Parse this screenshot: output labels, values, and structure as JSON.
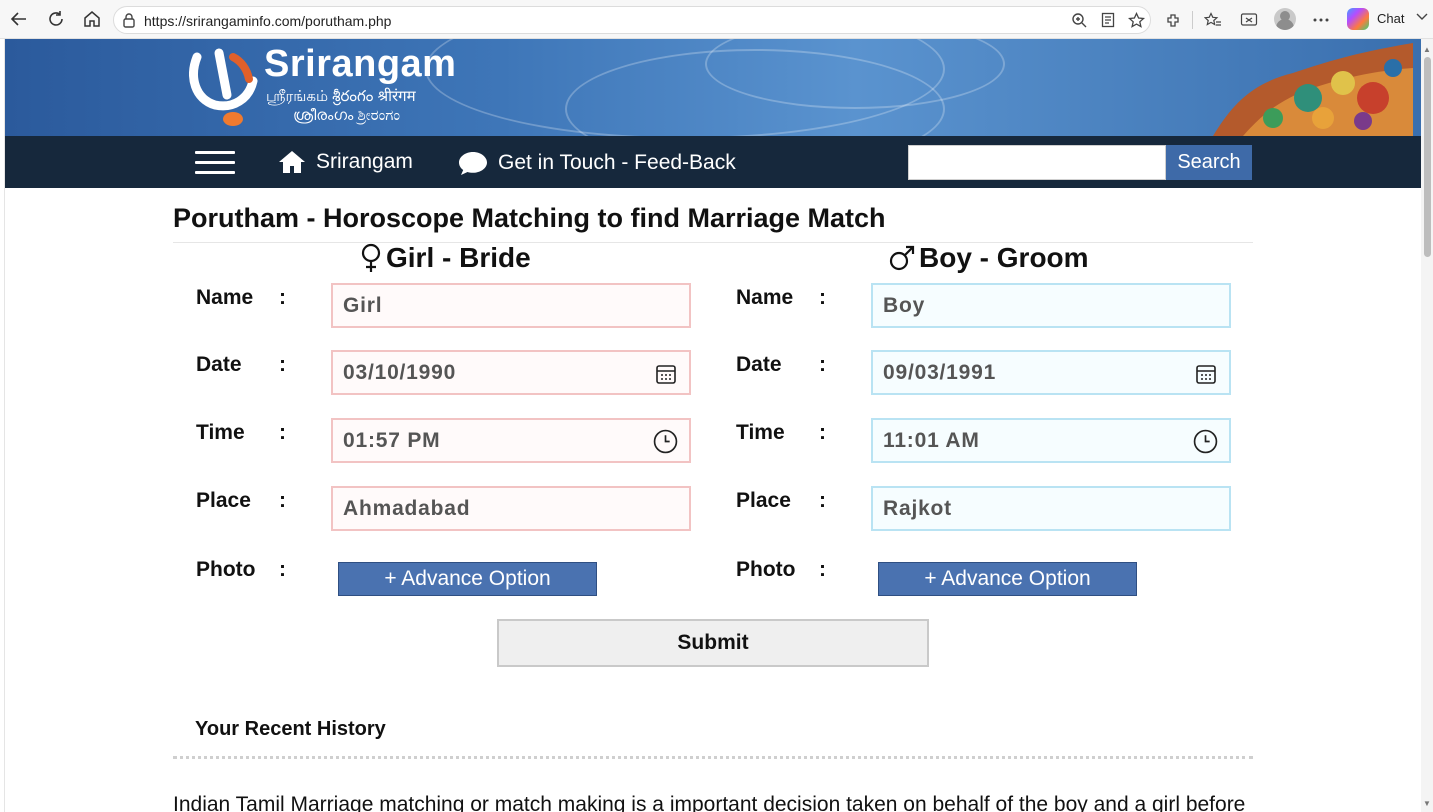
{
  "browser": {
    "url": "https://srirangaminfo.com/porutham.php",
    "chat_label": "Chat",
    "icons": [
      "back-icon",
      "reload-icon",
      "home-icon",
      "lock-icon",
      "zoom-icon",
      "reader-icon",
      "favorite-icon",
      "extensions-icon",
      "favorites-bar-icon",
      "collections-icon",
      "profile-icon",
      "more-icon",
      "copilot-icon"
    ]
  },
  "site": {
    "title": "Srirangam",
    "subtitle_line1": "ஸ்ரீரங்கம்  శ్రీరంగం  श्रीरंगम",
    "subtitle_line2": "ശ്രീരംഗം  ಶ್ರೀರಂಗಂ"
  },
  "nav": {
    "home_label": "Srirangam",
    "contact_label": "Get in Touch - Feed-Back",
    "search_value": "",
    "search_button": "Search"
  },
  "main": {
    "page_title": "Porutham - Horoscope Matching to find Marriage Match",
    "girl": {
      "heading": "Girl - Bride",
      "name": "Girl",
      "date": "03/10/1990",
      "time": "01:57  PM",
      "place": "Ahmadabad",
      "advance_button": "+ Advance Option"
    },
    "boy": {
      "heading": "Boy - Groom",
      "name": "Boy",
      "date": "09/03/1991",
      "time": "11:01  AM",
      "place": "Rajkot",
      "advance_button": "+ Advance Option"
    },
    "labels": {
      "name": "Name",
      "date": "Date",
      "time": "Time",
      "place": "Place",
      "photo": "Photo",
      "colon": ":"
    },
    "submit_label": "Submit",
    "history_title": "Your Recent History",
    "intro_text": "Indian Tamil Marriage matching or match making is a important decision taken on behalf of the boy and a girl before"
  },
  "colors": {
    "banner_blue": "#3e76b8",
    "nav_dark": "#16283c",
    "button_blue": "#4a72b0",
    "girl_border": "#f2c3c3",
    "boy_border": "#b9e3f3"
  }
}
